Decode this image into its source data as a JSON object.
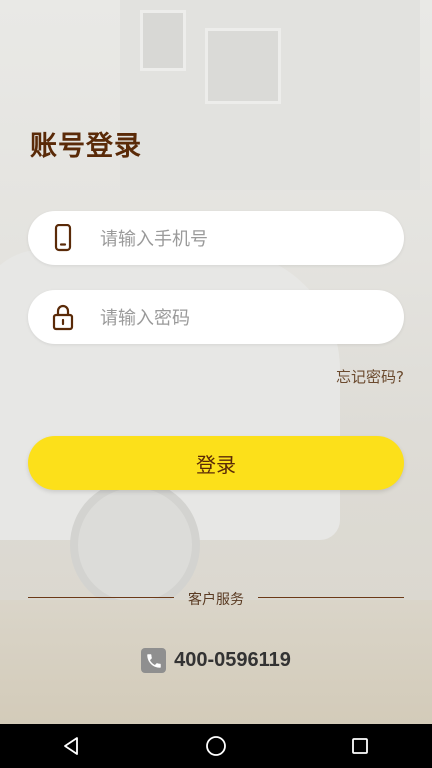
{
  "page": {
    "title": "账号登录"
  },
  "phone_field": {
    "placeholder": "请输入手机号",
    "icon": "smartphone-icon"
  },
  "password_field": {
    "placeholder": "请输入密码",
    "icon": "lock-icon"
  },
  "forgot_password": "忘记密码?",
  "login_button": "登录",
  "customer_service": {
    "label": "客户服务",
    "phone_number": "400-0596119",
    "icon": "phone-icon"
  },
  "system_nav": {
    "back_icon": "back-triangle-icon",
    "home_icon": "home-circle-icon",
    "recents_icon": "recents-square-icon"
  },
  "colors": {
    "title": "#5a2a08",
    "button_bg": "#fce01a",
    "button_text": "#5a2a08",
    "divider": "#6b3a18"
  }
}
